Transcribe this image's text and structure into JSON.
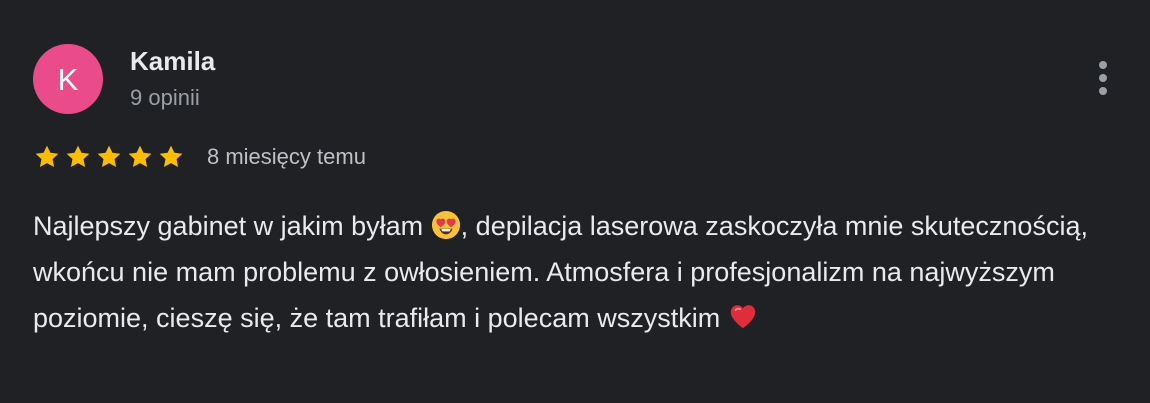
{
  "review": {
    "author": {
      "initial": "K",
      "name": "Kamila",
      "review_count": "9 opinii"
    },
    "rating": {
      "value": 5,
      "max": 5,
      "star_color": "#fbbc04"
    },
    "time_ago": "8 miesięcy temu",
    "text_parts": {
      "part1": "Najlepszy gabinet w jakim byłam ",
      "part2": ", depilacja laserowa zaskoczyła mnie skutecznością, wkońcu nie mam problemu z owłosieniem. Atmosfera i profesjonalizm na najwyższym poziomie, cieszę się, że tam trafiłam i polecam wszystkim "
    },
    "emojis": {
      "heart_eyes": "heart-eyes-emoji",
      "red_heart": "red-heart-emoji"
    }
  },
  "colors": {
    "background": "#202124",
    "avatar": "#ea4b8a",
    "primary_text": "#e8eaed",
    "secondary_text": "#9aa0a6",
    "star": "#fbbc04",
    "heart": "#e02d3c"
  },
  "icons": {
    "more": "more-vertical-icon",
    "star": "star-icon"
  }
}
